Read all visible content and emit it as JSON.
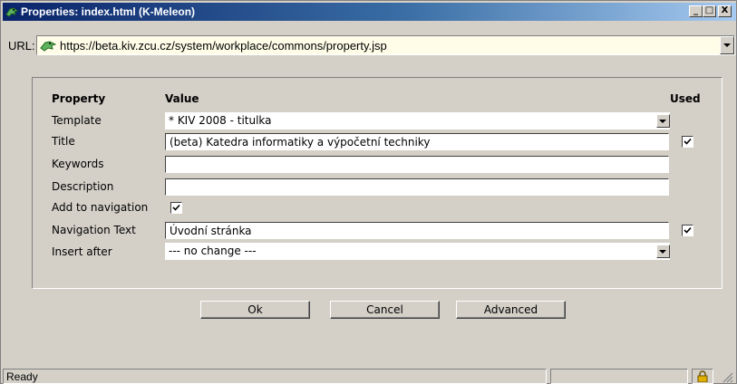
{
  "window": {
    "title": "Properties: index.html (K-Meleon)",
    "controls": {
      "minimize": "_",
      "maximize": "□",
      "close": "X"
    }
  },
  "urlbar": {
    "label": "URL:",
    "value": "https://beta.kiv.zcu.cz/system/workplace/commons/property.jsp"
  },
  "form": {
    "headers": {
      "property": "Property",
      "value": "Value",
      "used": "Used"
    },
    "rows": [
      {
        "label": "Template",
        "type": "select",
        "value": "* KIV 2008 - titulka"
      },
      {
        "label": "Title",
        "type": "text",
        "value": "(beta) Katedra informatiky a výpočetní techniky",
        "used": true
      },
      {
        "label": "Keywords",
        "type": "text",
        "value": ""
      },
      {
        "label": "Description",
        "type": "text",
        "value": ""
      },
      {
        "label": "Add to navigation",
        "type": "checkbox",
        "checked": true
      },
      {
        "label": "Navigation Text",
        "type": "text",
        "value": "Úvodní stránka",
        "used": true
      },
      {
        "label": "Insert after",
        "type": "select",
        "value": "--- no change ---"
      }
    ]
  },
  "buttons": {
    "ok": "Ok",
    "cancel": "Cancel",
    "advanced": "Advanced"
  },
  "status": {
    "text": "Ready"
  },
  "colors": {
    "titlebar_start": "#0a246a",
    "titlebar_end": "#a6caf0",
    "url_bg": "#fffde8",
    "face": "#d4d0c8"
  }
}
